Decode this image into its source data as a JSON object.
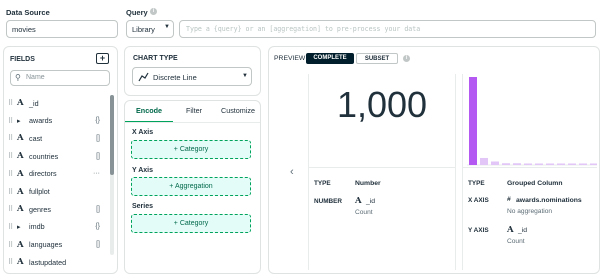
{
  "data_source": {
    "label": "Data Source",
    "value": "movies"
  },
  "query": {
    "label": "Query",
    "info_icon": "info-icon",
    "language": "Library",
    "placeholder": "Type a {query} or an [aggregation] to pre-process your data"
  },
  "fields": {
    "label": "FIELDS",
    "add_symbol": "+",
    "search_placeholder": "Name",
    "items": [
      {
        "type": "A",
        "name": "_id",
        "symbol": "",
        "expandable": false
      },
      {
        "type": "",
        "name": "awards",
        "symbol": "{}",
        "expandable": true
      },
      {
        "type": "A",
        "name": "cast",
        "symbol": "[]",
        "expandable": false
      },
      {
        "type": "A",
        "name": "countries",
        "symbol": "[]",
        "expandable": false
      },
      {
        "type": "A",
        "name": "directors",
        "symbol": "···",
        "expandable": false
      },
      {
        "type": "A",
        "name": "fullplot",
        "symbol": "",
        "expandable": false
      },
      {
        "type": "A",
        "name": "genres",
        "symbol": "[]",
        "expandable": false
      },
      {
        "type": "",
        "name": "imdb",
        "symbol": "{}",
        "expandable": true
      },
      {
        "type": "A",
        "name": "languages",
        "symbol": "[]",
        "expandable": false
      },
      {
        "type": "A",
        "name": "lastupdated",
        "symbol": "",
        "expandable": false
      }
    ]
  },
  "chart_type": {
    "label": "CHART TYPE",
    "value": "Discrete Line"
  },
  "tabs": [
    "Encode",
    "Filter",
    "Customize"
  ],
  "encode": {
    "x_axis": {
      "label": "X Axis",
      "drop": "+ Category"
    },
    "y_axis": {
      "label": "Y Axis",
      "drop": "+ Aggregation"
    },
    "series": {
      "label": "Series",
      "drop": "+ Category"
    }
  },
  "preview": {
    "label": "PREVIEW",
    "complete": "COMPLETE",
    "subset": "SUBSET",
    "info_icon": "info-icon",
    "number_card": {
      "value": "1,000",
      "type_key": "TYPE",
      "type_value": "Number",
      "number_key": "NUMBER",
      "field_icon": "A",
      "field_name": "_id",
      "field_sub": "Count"
    },
    "grouped_card": {
      "type_key": "TYPE",
      "type_value": "Grouped Column",
      "x_key": "X AXIS",
      "x_icon": "#",
      "x_field": "awards.nominations",
      "x_sub": "No aggregation",
      "y_key": "Y AXIS",
      "y_icon": "A",
      "y_field": "_id",
      "y_sub": "Count"
    }
  },
  "chart_data": {
    "type": "bar",
    "values": [
      100,
      8,
      4,
      2,
      2,
      1,
      1,
      1,
      1,
      1,
      1,
      1
    ],
    "color": "#b45af2"
  },
  "colors": {
    "accent": "#00a35c",
    "brand_dark": "#001e2b",
    "bar": "#b45af2"
  }
}
